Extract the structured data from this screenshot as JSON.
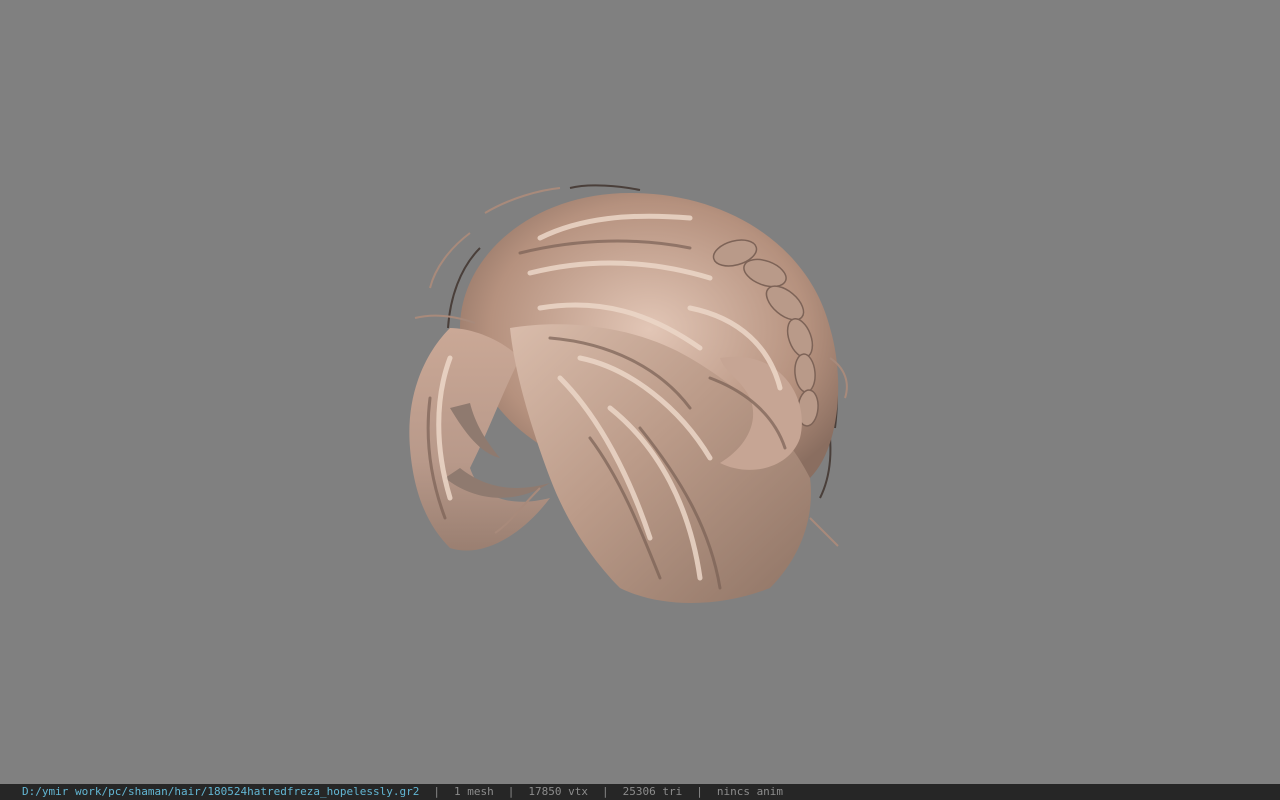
{
  "viewport": {
    "background": "#808080",
    "model_semantic": "hair-mesh-render",
    "hair_colors": {
      "base": "#b89784",
      "highlight": "#e9d2c2",
      "shadow": "#6e5a50",
      "dark_strand": "#3c3431"
    }
  },
  "statusbar": {
    "path": "D:/ymir work/pc/shaman/hair/180524hatredfreza_hopelessly.gr2",
    "separator": "|",
    "mesh_count": "1 mesh",
    "vertex_count": "17850 vtx",
    "triangle_count": "25306 tri",
    "anim": "nincs anim"
  }
}
